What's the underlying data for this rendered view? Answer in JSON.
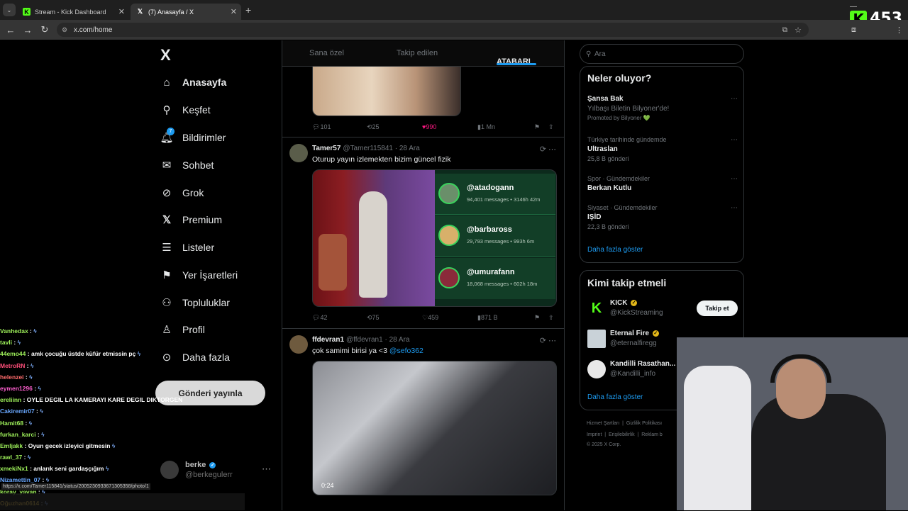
{
  "browser": {
    "tabs": [
      {
        "title": "Stream - Kick Dashboard",
        "icon": "kick-icon"
      },
      {
        "title": "(7) Anasayfa / X",
        "icon": "x-icon"
      }
    ],
    "url": "x.com/home",
    "overlay_counter": "453"
  },
  "sidebar": {
    "logo": "X",
    "items": [
      {
        "label": "Anasayfa",
        "icon": "home-icon"
      },
      {
        "label": "Keşfet",
        "icon": "search-icon"
      },
      {
        "label": "Bildirimler",
        "icon": "bell-icon",
        "badge": "7"
      },
      {
        "label": "Sohbet",
        "icon": "mail-icon"
      },
      {
        "label": "Grok",
        "icon": "grok-icon"
      },
      {
        "label": "Premium",
        "icon": "x-icon"
      },
      {
        "label": "Listeler",
        "icon": "list-icon"
      },
      {
        "label": "Yer İşaretleri",
        "icon": "bookmark-icon"
      },
      {
        "label": "Topluluklar",
        "icon": "communities-icon"
      },
      {
        "label": "Profil",
        "icon": "person-icon"
      },
      {
        "label": "Daha fazla",
        "icon": "more-circle-icon"
      }
    ],
    "post_button": "Gönderi yayınla",
    "account": {
      "name": "berke",
      "handle": "@berkegulerr"
    }
  },
  "feed": {
    "tabs": [
      "Sana özel",
      "Takip edilen",
      "ATABARI"
    ],
    "posts": [
      {
        "stats": {
          "replies": "101",
          "reposts": "25",
          "likes": "990",
          "views": "1 Mn"
        }
      },
      {
        "name": "Tamer57",
        "handle": "@Tamer115841",
        "date": "28 Ara",
        "text": "Oturup yayın izlemekten bizim güncel fizik",
        "leaderboard": [
          {
            "user": "@atadogann",
            "stats": "94,401 messages • 3146h 42m"
          },
          {
            "user": "@barbaross",
            "stats": "29,793 messages • 993h 6m"
          },
          {
            "user": "@umurafann",
            "stats": "18,068 messages • 602h 18m"
          }
        ],
        "stats": {
          "replies": "42",
          "reposts": "75",
          "likes": "459",
          "views": "871 B"
        }
      },
      {
        "name": "ffdevran1",
        "handle": "@ffdevran1",
        "date": "28 Ara",
        "text": "çok samimi birisi ya <3",
        "mention": "@sefo362",
        "video_time": "0:24"
      }
    ]
  },
  "right": {
    "search_placeholder": "Ara",
    "trends_title": "Neler oluyor?",
    "trends": [
      {
        "context": "",
        "title": "Şansa Bak",
        "sub": "Yılbaşı Biletin Bilyoner'de!",
        "count": "Promoted by Bilyoner 💚"
      },
      {
        "context": "Türkiye tarihinde gündemde",
        "title": "Ultraslan",
        "sub": "",
        "count": "25,8 B gönderi"
      },
      {
        "context": "Spor · Gündemdekiler",
        "title": "Berkan Kutlu",
        "sub": "",
        "count": ""
      },
      {
        "context": "Siyaset · Gündemdekiler",
        "title": "IŞİD",
        "sub": "",
        "count": "22,3 B gönderi"
      }
    ],
    "show_more": "Daha fazla göster",
    "who_title": "Kimi takip etmeli",
    "who": [
      {
        "name": "KICK",
        "handle": "@KickStreaming",
        "button": "Takip et"
      },
      {
        "name": "Eternal Fire",
        "handle": "@eternalfiregg",
        "button": ""
      },
      {
        "name": "Kandilli Rasathan...",
        "handle": "@Kandilli_info",
        "button": ""
      }
    ],
    "who_more": "Daha fazla göster",
    "footer": [
      "Hizmet Şartları",
      "Gizlilik Politikası",
      "Imprint",
      "Erişilebilirlik",
      "Reklam b",
      "© 2025 X Corp."
    ]
  },
  "chat": [
    {
      "user": "Vanhedax",
      "color": "#9ef05a",
      "msg": ""
    },
    {
      "user": "tavli",
      "color": "#9ef05a",
      "msg": ""
    },
    {
      "user": "44emo44",
      "color": "#9ef05a",
      "msg": "amk çocuğu üstde küfür etmissin pç"
    },
    {
      "user": "MetroRN",
      "color": "#ff4f7a",
      "msg": ""
    },
    {
      "user": "helenzei",
      "color": "#ff6b6b",
      "msg": ""
    },
    {
      "user": "eymen1296",
      "color": "#ff5fd0",
      "msg": ""
    },
    {
      "user": "ereliinn",
      "color": "#9ef05a",
      "msg": "OYLE DEGIL LA KAMERAYI KARE DEGIL DIKTORGEN YAP"
    },
    {
      "user": "Cakiremir07",
      "color": "#6aa8ff",
      "msg": ""
    },
    {
      "user": "Hamit68",
      "color": "#9ef05a",
      "msg": ""
    },
    {
      "user": "furkan_karci",
      "color": "#9ef05a",
      "msg": ""
    },
    {
      "user": "Emljakk",
      "color": "#9ef05a",
      "msg": "Oyun gecek izleyici gitmesin"
    },
    {
      "user": "rawl_37",
      "color": "#9ef05a",
      "msg": ""
    },
    {
      "user": "xmekiNx1",
      "color": "#9ef05a",
      "msg": "anlarık seni gardaşçığım"
    },
    {
      "user": "Nizamettin_07",
      "color": "#6aa8ff",
      "msg": ""
    },
    {
      "user": "koray_yavan",
      "color": "#9ef05a",
      "msg": ""
    },
    {
      "user": "Oğuzhan0614",
      "color": "#ffd24a",
      "msg": ""
    }
  ],
  "status_url": "https://x.com/Tamer115841/status/2005230933671305358/photo/1"
}
